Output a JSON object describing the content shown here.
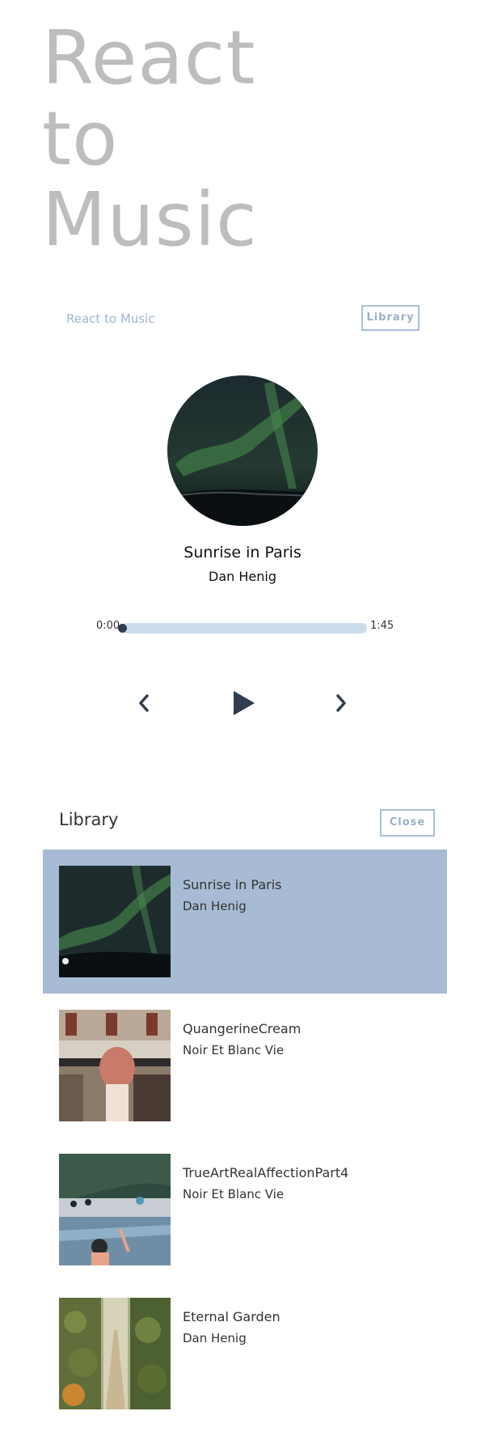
{
  "hero": {
    "lines": [
      "React",
      "to",
      "Music"
    ]
  },
  "nav": {
    "brand": "React to Music",
    "library_button": "Library"
  },
  "player": {
    "song_title": "Sunrise in Paris",
    "artist": "Dan Henig",
    "current_time": "0:00",
    "duration": "1:45",
    "progress": 0.0,
    "controls": {
      "prev_icon": "chevron-left-icon",
      "play_icon": "play-icon",
      "next_icon": "chevron-right-icon"
    }
  },
  "library": {
    "title": "Library",
    "close_button": "Close",
    "items": [
      {
        "name": "Sunrise in Paris",
        "artist": "Dan Henig",
        "active": true
      },
      {
        "name": "QuangerineCream",
        "artist": "Noir Et Blanc Vie",
        "active": false
      },
      {
        "name": "TrueArtRealAffectionPart4",
        "artist": "Noir Et Blanc Vie",
        "active": false
      },
      {
        "name": "Eternal Garden",
        "artist": "Dan Henig",
        "active": false
      }
    ]
  },
  "colors": {
    "accent": "#a7bbd4",
    "track": "#cddcec",
    "thumb": "#2f3d4e",
    "hero_text": "#bdbdbd"
  }
}
